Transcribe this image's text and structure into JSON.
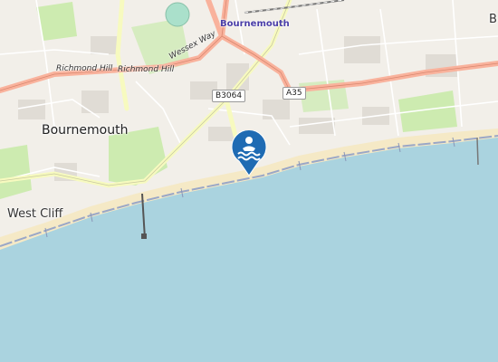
{
  "map": {
    "place_labels": {
      "bournemouth_main": "Bournemouth",
      "west_cliff": "West Cliff",
      "station": "Bournemouth",
      "edge_letter": "B"
    },
    "roads": {
      "richmond_hill_1": "Richmond Hill",
      "richmond_hill_2": "Richmond Hill",
      "wessex_way": "Wessex Way",
      "b3064": "B3064",
      "a35": "A35"
    },
    "marker": {
      "icon": "swimming-icon",
      "color": "#1f6bb3"
    },
    "colors": {
      "sea": "#aad3df",
      "land": "#f2efe9",
      "beach": "#f5e9c6",
      "park": "#cdebb0",
      "main_road": "#f9b29c",
      "secondary_road": "#f7fabf"
    }
  }
}
